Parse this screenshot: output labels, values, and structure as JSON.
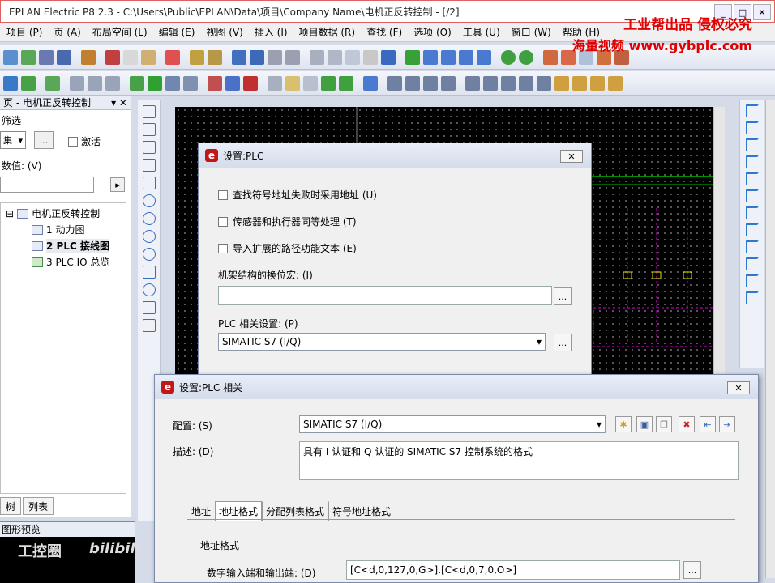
{
  "window": {
    "title": "EPLAN Electric P8 2.3 - C:\\Users\\Public\\EPLAN\\Data\\项目\\Company Name\\电机正反转控制 - [/2]",
    "min_label": "_",
    "max_label": "□",
    "close_label": "✕"
  },
  "watermark": {
    "line1": "工业帮出品 侵权必究",
    "line2": "海量视频 www.gybplc.com"
  },
  "menu": [
    "项目 (P)",
    "页 (A)",
    "布局空间 (L)",
    "编辑 (E)",
    "视图 (V)",
    "插入 (I)",
    "项目数据 (R)",
    "查找 (F)",
    "选项 (O)",
    "工具 (U)",
    "窗口 (W)",
    "帮助 (H)"
  ],
  "left_panel": {
    "title": "页 - 电机正反转控制",
    "filter_label": "筛选",
    "select_value": "集",
    "more_label": "...",
    "activate_label": "激活",
    "value_label": "数值: (V)",
    "go_label": "▸",
    "tree": [
      {
        "label": "电机正反转控制",
        "expand": "⊟"
      },
      {
        "label": "1 动力图",
        "expand": ""
      },
      {
        "label": "2 PLC 接线图",
        "expand": ""
      },
      {
        "label": "3 PLC IO 总览",
        "expand": ""
      }
    ],
    "tabs": [
      "树",
      "列表"
    ]
  },
  "preview": {
    "title": "图形预览",
    "logo_text": "工控圈",
    "logo_text2": "bilibili"
  },
  "dialog_plc": {
    "title": "设置:PLC",
    "close_label": "✕",
    "checks": [
      "查找符号地址失败时采用地址 (U)",
      "传感器和执行器同等处理 (T)",
      "导入扩展的路径功能文本 (E)"
    ],
    "rack_label": "机架结构的换位宏: (I)",
    "rack_value": "",
    "plc_settings_label": "PLC 相关设置: (P)",
    "plc_settings_value": "SIMATIC S7 (I/Q)",
    "more_label": "..."
  },
  "dialog_plc_rel": {
    "title": "设置:PLC 相关",
    "close_label": "✕",
    "config_label": "配置: (S)",
    "config_value": "SIMATIC S7 (I/Q)",
    "desc_label": "描述: (D)",
    "desc_value": "具有 I 认证和 Q 认证的 SIMATIC S7 控制系统的格式",
    "tabs": [
      "地址",
      "地址格式",
      "分配列表格式",
      "符号地址格式"
    ],
    "group_label": "地址格式",
    "digital_label": "数字输入端和输出端: (D)",
    "digital_value": "[C<d,0,127,0,G>].[C<d,0,7,0,O>]",
    "more_label": "..."
  },
  "colors": {
    "canvas_bg": "#000000",
    "canvas_green": "#00c000",
    "canvas_magenta": "#e000e0",
    "canvas_yellow": "#e0e000",
    "accent_red": "#e00000"
  }
}
